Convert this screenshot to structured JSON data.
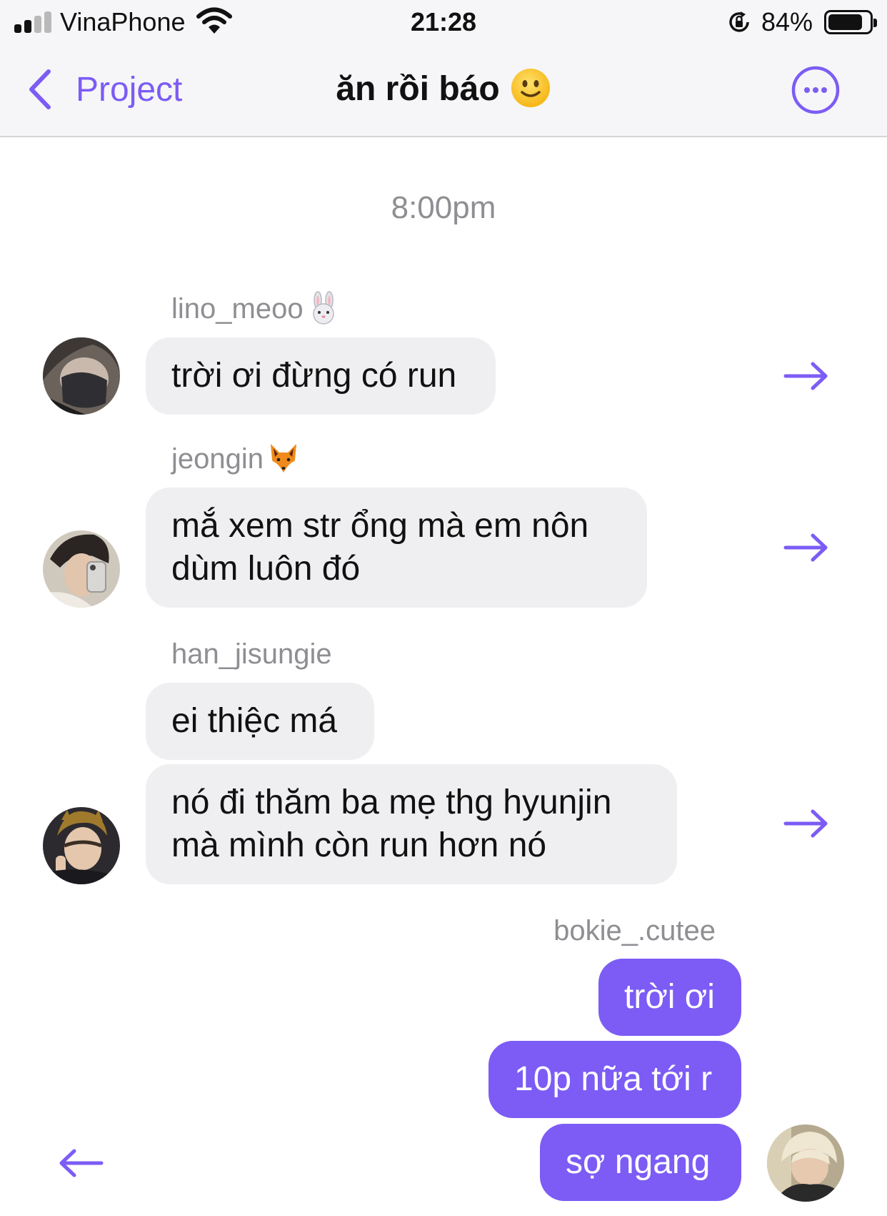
{
  "status_bar": {
    "carrier": "VinaPhone",
    "time": "21:28",
    "battery_percent": "84%",
    "battery_level": 0.84,
    "signal_bars": 2,
    "icons": [
      "signal-icon",
      "wifi-icon",
      "orientation-lock-icon",
      "battery-icon"
    ]
  },
  "nav": {
    "back_label": "Project",
    "title": "ăn rồi báo",
    "title_emoji": "slightly-smiling-face-emoji",
    "more_icon": "ellipsis-circle-icon"
  },
  "chat": {
    "timestamp": "8:00pm",
    "messages": [
      {
        "sender": "lino_meoo",
        "sender_emoji": "rabbit-face-emoji",
        "text": "trời ơi đừng có run",
        "direction": "incoming"
      },
      {
        "sender": "jeongin",
        "sender_emoji": "fox-face-emoji",
        "text": "mắ xem str ổng mà em nôn dùm luôn đó",
        "direction": "incoming"
      },
      {
        "sender": "han_jisungie",
        "text": "ei thiệc má",
        "direction": "incoming"
      },
      {
        "text": "nó đi thăm ba mẹ thg hyunjin mà mình còn run hơn nó",
        "direction": "incoming"
      },
      {
        "sender": "bokie_.cutee",
        "text": "trời ơi",
        "direction": "outgoing"
      },
      {
        "text": "10p nữa tới r",
        "direction": "outgoing"
      },
      {
        "text": "sợ ngang",
        "direction": "outgoing"
      }
    ]
  },
  "colors": {
    "accent": "#7c5cf5",
    "incoming_bubble": "#efeff1",
    "outgoing_bubble": "#7c5cf5",
    "secondary_text": "#8e8e93",
    "bar_background": "#f6f6f8"
  }
}
